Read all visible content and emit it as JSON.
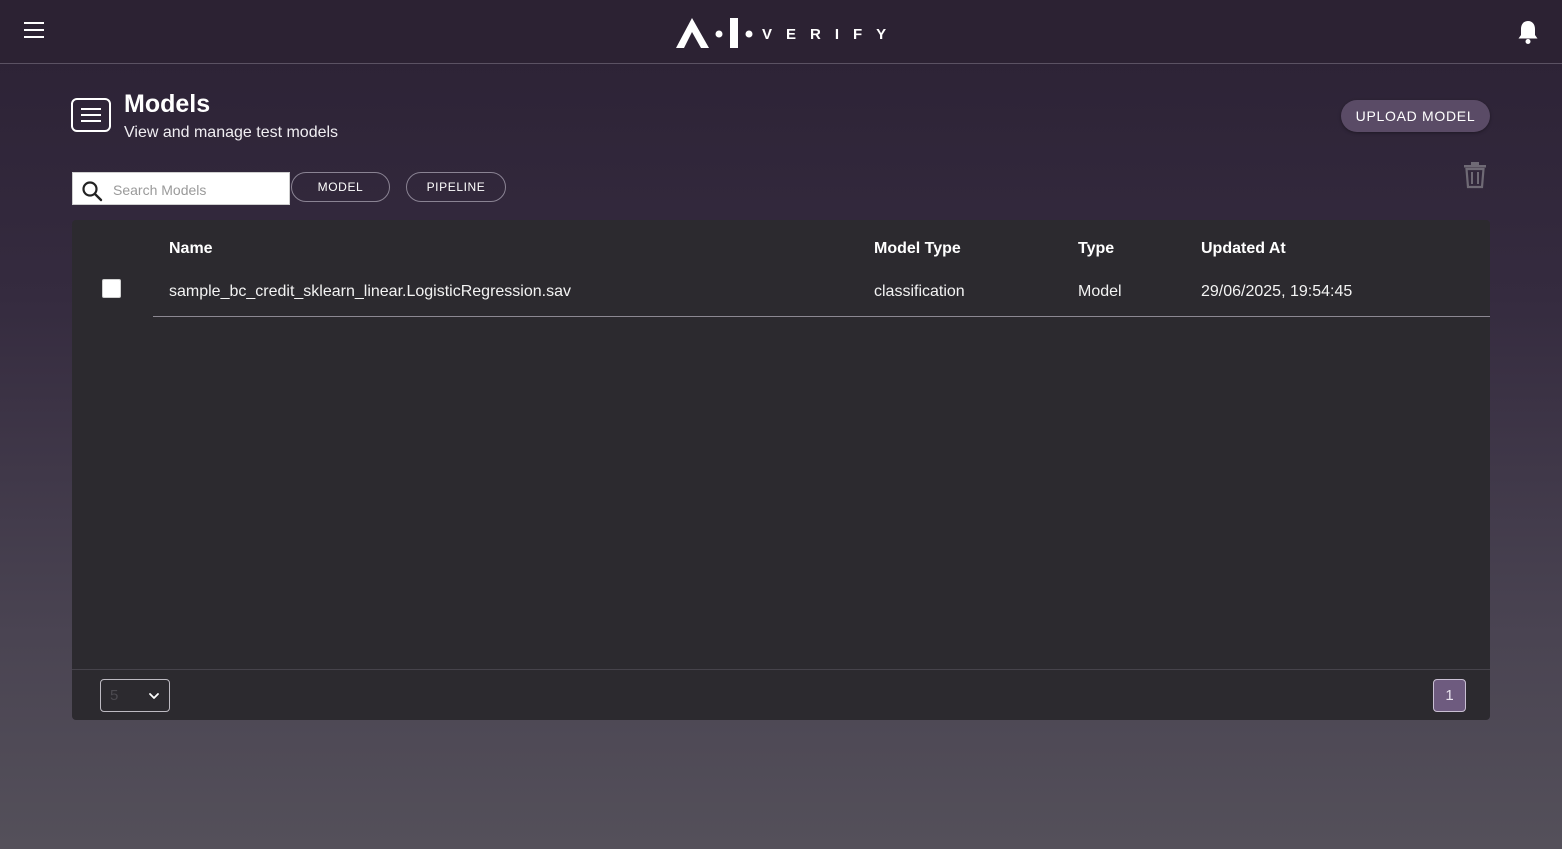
{
  "header": {
    "logo_text": "A·I·VERIFY",
    "menu_icon": "hamburger-menu-icon",
    "notification_icon": "bell-icon"
  },
  "page": {
    "icon": "list-document-icon",
    "title": "Models",
    "subtitle": "View and manage test models",
    "upload_label": "UPLOAD MODEL"
  },
  "toolbar": {
    "search_placeholder": "Search Models",
    "search_value": "",
    "filters": [
      "MODEL",
      "PIPELINE"
    ],
    "delete_icon": "trash-icon"
  },
  "table": {
    "columns": [
      "Name",
      "Model Type",
      "Type",
      "Updated At"
    ],
    "rows": [
      {
        "checked": false,
        "name": "sample_bc_credit_sklearn_linear.LogisticRegression.sav",
        "model_type": "classification",
        "type": "Model",
        "updated_at": "29/06/2025, 19:54:45"
      }
    ]
  },
  "pagination": {
    "page_size": "5",
    "current_page": "1"
  },
  "colors": {
    "topbar": "#2c2233",
    "card": "#2c2a2f",
    "accent_button": "#5a4b66",
    "active_page": "#6e5b7f"
  }
}
